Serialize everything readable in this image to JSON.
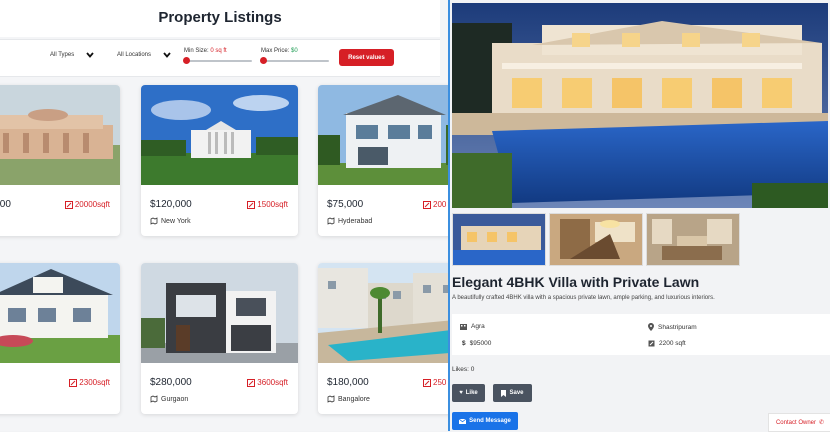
{
  "header": {
    "title": "Property Listings"
  },
  "filters": {
    "type_label": "All Types",
    "location_label": "All Locations",
    "min_size_label": "Min Size:",
    "min_size_value": "0 sq ft",
    "min_size_fraction": 0,
    "max_price_label": "Max Price:",
    "max_price_value": "$0",
    "max_price_fraction": 0,
    "reset_label": "Reset values"
  },
  "listings": [
    {
      "price": ",000,000",
      "size": "20000sqft",
      "location": "i",
      "image_icon": "parliament-building"
    },
    {
      "price": "$120,000",
      "size": "1500sqft",
      "location": "New York",
      "image_icon": "white-house"
    },
    {
      "price": "$75,000",
      "size": "200",
      "location": "Hyderabad",
      "image_icon": "modern-house"
    },
    {
      "price": "0",
      "size": "2300sqft",
      "location": "ur",
      "image_icon": "craftsman-house"
    },
    {
      "price": "$280,000",
      "size": "3600sqft",
      "location": "Gurgaon",
      "image_icon": "modern-villa"
    },
    {
      "price": "$180,000",
      "size": "250",
      "location": "Bangalore",
      "image_icon": "apartment-pool"
    }
  ],
  "detail": {
    "title": "Elegant 4BHK Villa with Private Lawn",
    "description": "A beautifully crafted 4BHK villa with a spacious private lawn, ample parking, and luxurious interiors.",
    "city": "Agra",
    "area": "Shastripuram",
    "price": "$95000",
    "size": "2200 sqft",
    "likes_label": "Likes:",
    "likes_count": "0",
    "like_button": "Like",
    "save_button": "Save",
    "send_button": "Send Message",
    "contact_button": "Contact Owner"
  },
  "colors": {
    "accent": "#d61f26",
    "primary": "#1a73e8",
    "divider": "#3b8fe0",
    "dark_button": "#4a5360"
  }
}
